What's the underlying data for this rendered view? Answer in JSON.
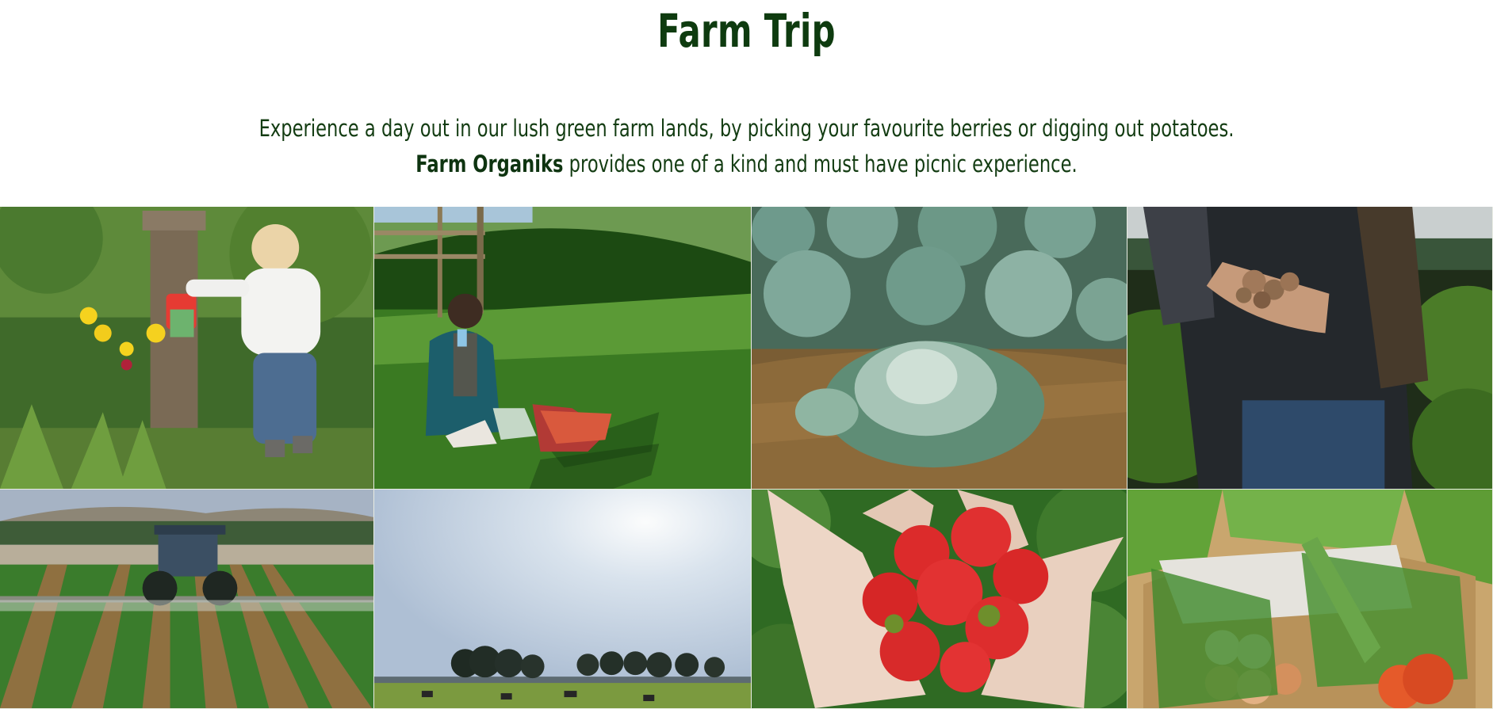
{
  "header": {
    "title": "Farm Trip",
    "intro_line1": "Experience a day out in our lush green farm lands, by picking your favourite berries or digging out potatoes.",
    "intro_brand": "Farm Organiks",
    "intro_line2_rest": " provides one of a kind and must have picnic experience."
  },
  "gallery": {
    "tiles": [
      {
        "subject": "child watering flowers"
      },
      {
        "subject": "picnic on grass"
      },
      {
        "subject": "cabbage field"
      },
      {
        "subject": "hand holding potatoes"
      },
      {
        "subject": "tractor spraying crops"
      },
      {
        "subject": "field with trees and cows"
      },
      {
        "subject": "hands holding strawberries"
      },
      {
        "subject": "basket of eggs and herbs"
      }
    ]
  }
}
